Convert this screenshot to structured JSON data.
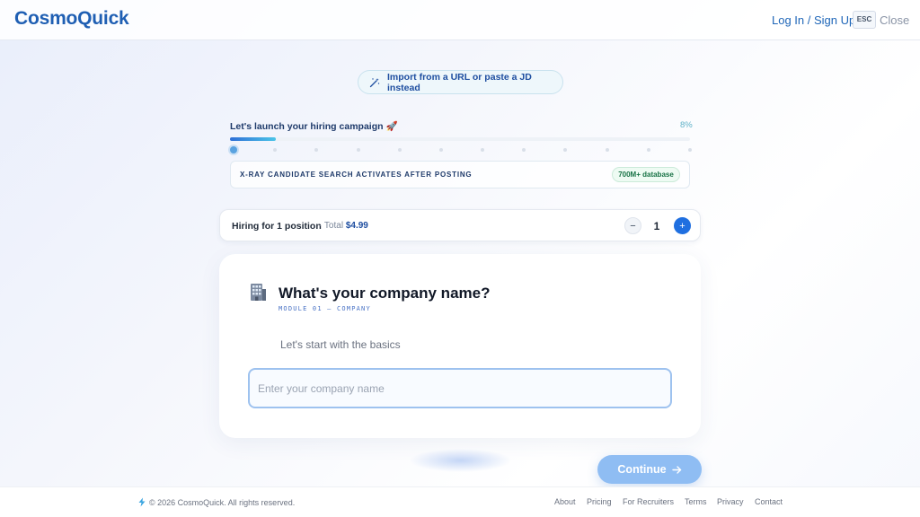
{
  "header": {
    "logo": "CosmoQuick",
    "login_label": "Log In / Sign Up",
    "esc_key": "ESC",
    "close_label": "Close"
  },
  "import": {
    "label": "Import from a URL or paste a JD instead",
    "icon": "magic-wand-icon"
  },
  "campaign": {
    "title": "Let's launch your hiring campaign 🚀",
    "progress_text": "8%",
    "progress_fraction": 0.08,
    "total_steps": 12,
    "current_step": 1
  },
  "xray": {
    "text": "X-RAY CANDIDATE SEARCH ACTIVATES AFTER POSTING",
    "badge": "700M+ database"
  },
  "hiring": {
    "label": "Hiring for 1 position",
    "total_prefix": "· Total",
    "total_price": "$4.99",
    "minus": "−",
    "quantity": "1",
    "plus": "+"
  },
  "card": {
    "icon": "office-building-icon",
    "title": "What's your company name?",
    "module_label": "MODULE 01 — COMPANY",
    "subtitle": "Let's start with the basics",
    "input_placeholder": "Enter your company name",
    "input_value": ""
  },
  "continue": {
    "label": "Continue",
    "icon": "arrow-right-icon"
  },
  "footer": {
    "copyright": "© 2026 CosmoQuick. All rights reserved.",
    "links": [
      "About",
      "Pricing",
      "For Recruiters",
      "Terms",
      "Privacy",
      "Contact"
    ]
  },
  "colors": {
    "brand": "#1f5fb3",
    "accent": "#1f6fe0",
    "continue_disabled": "#8fbdf3",
    "badge_green": "#177245"
  }
}
